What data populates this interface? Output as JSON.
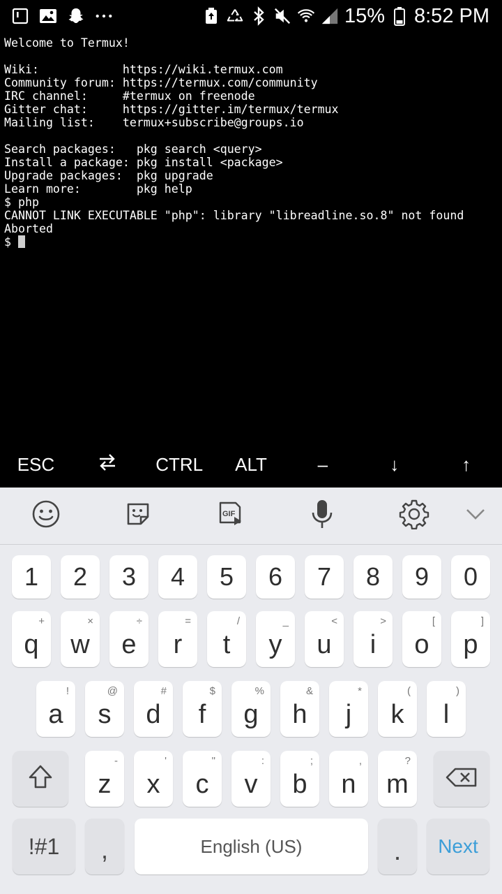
{
  "status_bar": {
    "battery_percent": "15%",
    "time": "8:52 PM",
    "left_icons": [
      "screenshot-icon",
      "gallery-icon",
      "snapchat-icon",
      "more-dots-icon"
    ],
    "right_icons": [
      "battery-saver-icon",
      "recycle-icon",
      "bluetooth-icon",
      "mute-icon",
      "wifi-icon",
      "signal-icon",
      "battery-icon"
    ]
  },
  "terminal": {
    "lines": [
      "Welcome to Termux!",
      "",
      "Wiki:            https://wiki.termux.com",
      "Community forum: https://termux.com/community",
      "IRC channel:     #termux on freenode",
      "Gitter chat:     https://gitter.im/termux/termux",
      "Mailing list:    termux+subscribe@groups.io",
      "",
      "Search packages:   pkg search <query>",
      "Install a package: pkg install <package>",
      "Upgrade packages:  pkg upgrade",
      "Learn more:        pkg help",
      "$ php",
      "CANNOT LINK EXECUTABLE \"php\": library \"libreadline.so.8\" not found",
      "Aborted"
    ],
    "prompt": "$ "
  },
  "extra_keys": {
    "esc": "ESC",
    "tab_icon": "tab-arrows-icon",
    "ctrl": "CTRL",
    "alt": "ALT",
    "dash": "–",
    "down": "↓",
    "up": "↑"
  },
  "keyboard_toolbar": {
    "items": [
      "emoji-icon",
      "sticker-icon",
      "gif-icon",
      "microphone-icon",
      "settings-icon",
      "collapse-chevron-icon"
    ],
    "gif_label": "GIF"
  },
  "keyboard": {
    "number_row": [
      "1",
      "2",
      "3",
      "4",
      "5",
      "6",
      "7",
      "8",
      "9",
      "0"
    ],
    "row1": [
      {
        "key": "q",
        "hint": "+"
      },
      {
        "key": "w",
        "hint": "×"
      },
      {
        "key": "e",
        "hint": "÷"
      },
      {
        "key": "r",
        "hint": "="
      },
      {
        "key": "t",
        "hint": "/"
      },
      {
        "key": "y",
        "hint": "_"
      },
      {
        "key": "u",
        "hint": "<"
      },
      {
        "key": "i",
        "hint": ">"
      },
      {
        "key": "o",
        "hint": "["
      },
      {
        "key": "p",
        "hint": "]"
      }
    ],
    "row2": [
      {
        "key": "a",
        "hint": "!"
      },
      {
        "key": "s",
        "hint": "@"
      },
      {
        "key": "d",
        "hint": "#"
      },
      {
        "key": "f",
        "hint": "$"
      },
      {
        "key": "g",
        "hint": "%"
      },
      {
        "key": "h",
        "hint": "&"
      },
      {
        "key": "j",
        "hint": "*"
      },
      {
        "key": "k",
        "hint": "("
      },
      {
        "key": "l",
        "hint": ")"
      }
    ],
    "row3": [
      {
        "key": "z",
        "hint": "-"
      },
      {
        "key": "x",
        "hint": "'"
      },
      {
        "key": "c",
        "hint": "\""
      },
      {
        "key": "v",
        "hint": ":"
      },
      {
        "key": "b",
        "hint": ";"
      },
      {
        "key": "n",
        "hint": ","
      },
      {
        "key": "m",
        "hint": "?"
      }
    ],
    "symbols_label": "!#1",
    "comma_label": ",",
    "space_label": "English (US)",
    "period_label": ".",
    "next_label": "Next",
    "accent_color": "#3c9ed8"
  }
}
